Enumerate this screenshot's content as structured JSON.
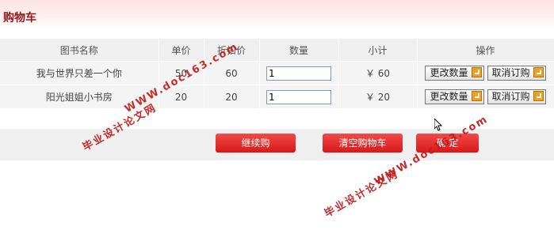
{
  "header": {
    "title": "购物车"
  },
  "table": {
    "headers": [
      "图书名称",
      "单价",
      "折扣价",
      "数量",
      "小计",
      "操作"
    ],
    "rows": [
      {
        "name": "我与世界只差一个你",
        "price": "50",
        "discount": "60",
        "qty": "1",
        "subtotal": "￥ 60"
      },
      {
        "name": "阳光姐姐小书房",
        "price": "20",
        "discount": "20",
        "qty": "1",
        "subtotal": "￥ 20"
      }
    ],
    "actions": {
      "update": "更改数量",
      "cancel": "取消订购"
    }
  },
  "buttons": {
    "continue": "继续购",
    "clear": "清空购物车",
    "confirm": "确 定"
  },
  "watermark": {
    "site": "WWW.doc163.com",
    "cn": "毕业设计论文网"
  },
  "colors": {
    "accent": "#d91818",
    "title": "#8b1a1a"
  }
}
